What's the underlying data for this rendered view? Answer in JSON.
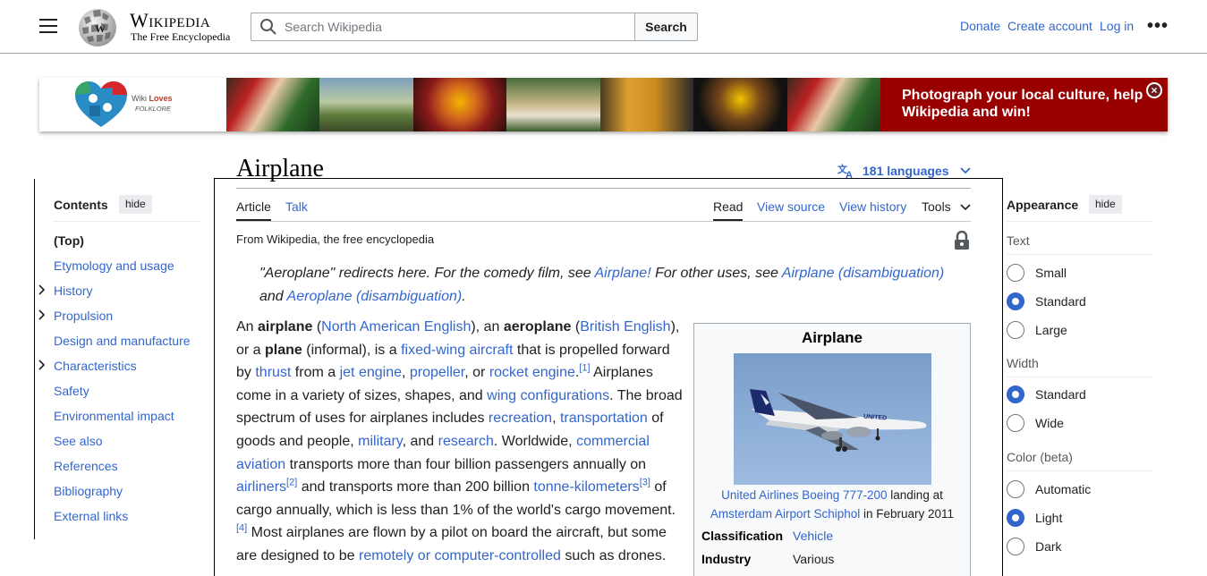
{
  "header": {
    "wordmark": "Wikipedia",
    "tagline": "The Free Encyclopedia",
    "search_placeholder": "Search Wikipedia",
    "search_button": "Search",
    "donate": "Donate",
    "create_account": "Create account",
    "log_in": "Log in",
    "more": "•••"
  },
  "banner": {
    "logo_text_1": "Wiki ",
    "logo_text_2": "Loves",
    "logo_text_3": "FOLKLORE",
    "message": "Photograph your local culture, help Wikipedia and win!",
    "close": "×"
  },
  "page": {
    "title": "Airplane",
    "languages": "181 languages",
    "tabs": {
      "article": "Article",
      "talk": "Talk",
      "read": "Read",
      "view_source": "View source",
      "view_history": "View history",
      "tools": "Tools"
    },
    "from": "From Wikipedia, the free encyclopedia"
  },
  "hatnote": {
    "t1": "\"Aeroplane\" redirects here. For the comedy film, see ",
    "l1": "Airplane!",
    "t2": " For other uses, see ",
    "l2": "Airplane (disambiguation)",
    "t3": " and ",
    "l3": "Aeroplane (disambiguation)",
    "t4": "."
  },
  "body": [
    {
      "t": "An "
    },
    {
      "b": "airplane"
    },
    {
      "t": " ("
    },
    {
      "l": "North American English"
    },
    {
      "t": "), an "
    },
    {
      "b": "aeroplane"
    },
    {
      "t": " ("
    },
    {
      "l": "British English"
    },
    {
      "t": "), or a "
    },
    {
      "b": "plane"
    },
    {
      "t": " (informal), is a "
    },
    {
      "l": "fixed-wing aircraft"
    },
    {
      "t": " that is propelled forward by "
    },
    {
      "l": "thrust"
    },
    {
      "t": " from a "
    },
    {
      "l": "jet engine"
    },
    {
      "t": ", "
    },
    {
      "l": "propeller"
    },
    {
      "t": ", or "
    },
    {
      "l": "rocket engine"
    },
    {
      "t": "."
    },
    {
      "s": "[1]"
    },
    {
      "t": " Airplanes come in a variety of sizes, shapes, and "
    },
    {
      "l": "wing configurations"
    },
    {
      "t": ". The broad spectrum of uses for airplanes includes "
    },
    {
      "l": "recreation"
    },
    {
      "t": ", "
    },
    {
      "l": "transportation"
    },
    {
      "t": " of goods and people, "
    },
    {
      "l": "military"
    },
    {
      "t": ", and "
    },
    {
      "l": "research"
    },
    {
      "t": ". Worldwide, "
    },
    {
      "l": "commercial aviation"
    },
    {
      "t": " transports more than four billion passengers annually on "
    },
    {
      "l": "airliners"
    },
    {
      "s": "[2]"
    },
    {
      "t": " and transports more than 200 billion "
    },
    {
      "l": "tonne-kilometers"
    },
    {
      "s": "[3]"
    },
    {
      "t": " of cargo annually, which is less than 1% of the world's cargo movement."
    },
    {
      "s": "[4]"
    },
    {
      "t": " Most airplanes are flown by a pilot on board the aircraft, but some are designed to be "
    },
    {
      "l": "remotely or computer-controlled"
    },
    {
      "t": " such as drones."
    }
  ],
  "infobox": {
    "title": "Airplane",
    "caption_link_1": "United Airlines Boeing 777-200",
    "caption_text_1": " landing at",
    "caption_link_2": "Amsterdam Airport Schiphol",
    "caption_text_2": " in February 2011",
    "livery": "UNITED",
    "rows": [
      {
        "label": "Classification",
        "value": "Vehicle",
        "link": true
      },
      {
        "label": "Industry",
        "value": "Various",
        "link": false
      }
    ]
  },
  "toc": {
    "heading": "Contents",
    "hide": "hide",
    "items": [
      {
        "label": "(Top)",
        "current": true,
        "expandable": false
      },
      {
        "label": "Etymology and usage",
        "current": false,
        "expandable": false
      },
      {
        "label": "History",
        "current": false,
        "expandable": true
      },
      {
        "label": "Propulsion",
        "current": false,
        "expandable": true
      },
      {
        "label": "Design and manufacture",
        "current": false,
        "expandable": false
      },
      {
        "label": "Characteristics",
        "current": false,
        "expandable": true
      },
      {
        "label": "Safety",
        "current": false,
        "expandable": false
      },
      {
        "label": "Environmental impact",
        "current": false,
        "expandable": false
      },
      {
        "label": "See also",
        "current": false,
        "expandable": false
      },
      {
        "label": "References",
        "current": false,
        "expandable": false
      },
      {
        "label": "Bibliography",
        "current": false,
        "expandable": false
      },
      {
        "label": "External links",
        "current": false,
        "expandable": false
      }
    ]
  },
  "appearance": {
    "heading": "Appearance",
    "hide": "hide",
    "text_label": "Text",
    "text_options": [
      {
        "label": "Small",
        "selected": false
      },
      {
        "label": "Standard",
        "selected": true
      },
      {
        "label": "Large",
        "selected": false
      }
    ],
    "width_label": "Width",
    "width_options": [
      {
        "label": "Standard",
        "selected": true
      },
      {
        "label": "Wide",
        "selected": false
      }
    ],
    "color_label": "Color (beta)",
    "color_options": [
      {
        "label": "Automatic",
        "selected": false
      },
      {
        "label": "Light",
        "selected": true
      },
      {
        "label": "Dark",
        "selected": false
      }
    ]
  },
  "colors": {
    "link": "#3366cc",
    "banner_red": "#990000",
    "text": "#202122"
  }
}
